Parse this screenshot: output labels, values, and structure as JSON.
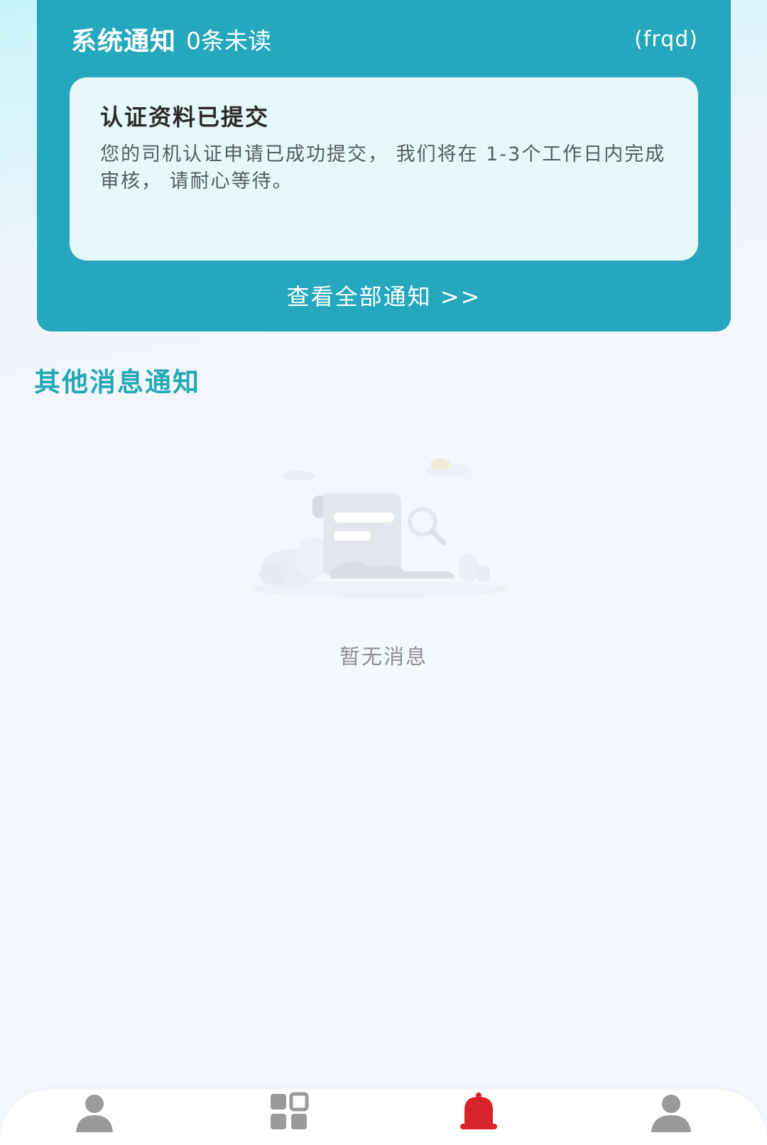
{
  "system_notice": {
    "title": "系统通知",
    "unread": "0条未读",
    "tag": "(frqd)",
    "latest": {
      "title": "认证资料已提交",
      "body": "您的司机认证申请已成功提交， 我们将在 1-3个工作日内完成审核， 请耐心等待。"
    },
    "view_all": "查看全部通知 >>"
  },
  "other_messages": {
    "title": "其他消息通知",
    "empty_text": "暂无消息",
    "empty_icon": "empty-document-icon"
  },
  "tabbar": {
    "tabs": [
      {
        "icon": "person-icon",
        "active": false
      },
      {
        "icon": "grid-icon",
        "active": false
      },
      {
        "icon": "bell-icon",
        "active": true
      },
      {
        "icon": "user-icon",
        "active": false
      }
    ],
    "active_color": "#d8232a",
    "inactive_color": "#9a9a9a"
  },
  "colors": {
    "accent": "#25a8bd",
    "section_title": "#21a9b4"
  }
}
